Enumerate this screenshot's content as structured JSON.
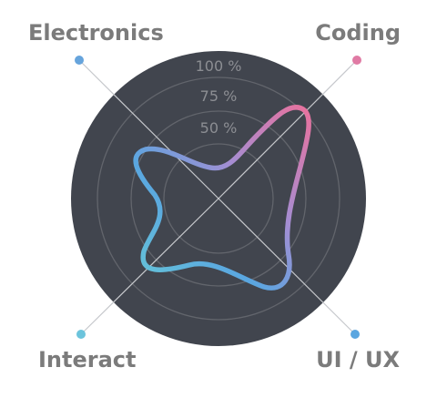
{
  "chart_data": {
    "type": "radar",
    "axes": [
      "Electronics",
      "Coding",
      "UI / UX",
      "Interact"
    ],
    "values": [
      44,
      89,
      82,
      62
    ],
    "ring_labels": [
      "100 %",
      "75 %",
      "50 %"
    ],
    "range": [
      0,
      100
    ],
    "colors": {
      "background": "#41454e",
      "grid": "#62656c",
      "spoke_line": "#c6c8cc",
      "dot_electronics": "#66a4dc",
      "dot_coding": "#e07aa4",
      "dot_ui_ux": "#5aa6e0",
      "dot_interact": "#6cc4dc",
      "gradient_stops": [
        "#e8729e",
        "#a58dd2",
        "#5aa6e0",
        "#66c6d8"
      ]
    }
  }
}
